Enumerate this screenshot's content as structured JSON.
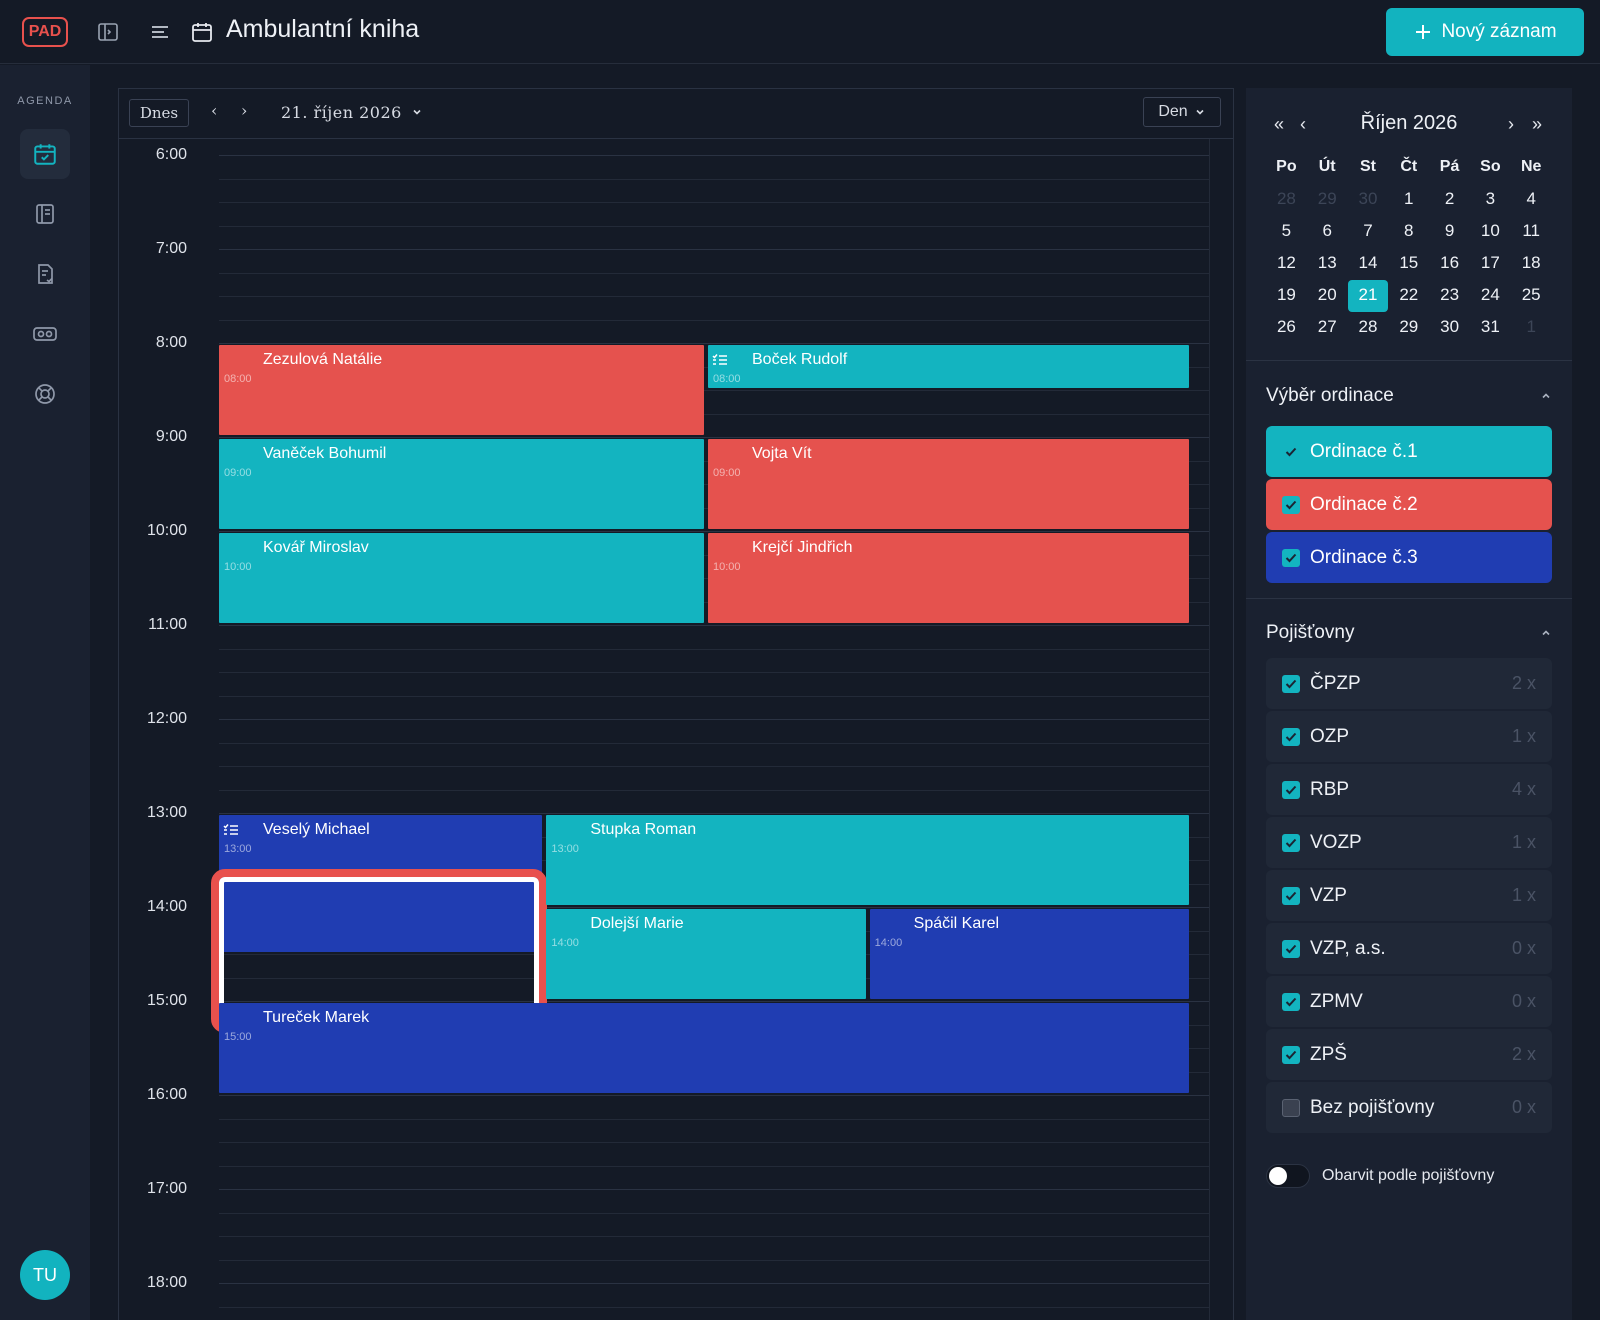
{
  "app": {
    "logo_text": "PAD",
    "title": "Ambulantní kniha",
    "new_button_label": "Nový záznam"
  },
  "rail": {
    "section_label": "AGENDA",
    "items": [
      {
        "icon": "calendar-check-icon",
        "active": true
      },
      {
        "icon": "book-icon",
        "active": false
      },
      {
        "icon": "document-heart-icon",
        "active": false
      },
      {
        "icon": "card-reader-icon",
        "active": false
      },
      {
        "icon": "lifebuoy-icon",
        "active": false
      }
    ],
    "user_initials": "TU"
  },
  "calendar": {
    "today_label": "Dnes",
    "prev_label": "‹",
    "next_label": "›",
    "date_label": "21. říjen 2026",
    "view_label": "Den",
    "hours": [
      "6:00",
      "7:00",
      "8:00",
      "9:00",
      "10:00",
      "11:00",
      "12:00",
      "13:00",
      "14:00",
      "15:00",
      "16:00",
      "17:00",
      "18:00"
    ],
    "events": [
      {
        "name": "Zezulová Natálie",
        "time": "08:00",
        "color": "red",
        "list_icon": false
      },
      {
        "name": "Boček Rudolf",
        "time": "08:00",
        "color": "teal",
        "list_icon": true
      },
      {
        "name": "Vaněček Bohumil",
        "time": "09:00",
        "color": "teal",
        "list_icon": false
      },
      {
        "name": "Vojta Vít",
        "time": "09:00",
        "color": "red",
        "list_icon": false
      },
      {
        "name": "Kovář Miroslav",
        "time": "10:00",
        "color": "teal",
        "list_icon": false
      },
      {
        "name": "Krejčí Jindřich",
        "time": "10:00",
        "color": "red",
        "list_icon": false
      },
      {
        "name": "Veselý Michael",
        "time": "13:00",
        "color": "blue",
        "list_icon": true,
        "highlighted": true
      },
      {
        "name": "Stupka Roman",
        "time": "13:00",
        "color": "teal",
        "list_icon": false
      },
      {
        "name": "Dolejší Marie",
        "time": "14:00",
        "color": "teal",
        "list_icon": false
      },
      {
        "name": "Spáčil Karel",
        "time": "14:00",
        "color": "blue",
        "list_icon": false
      },
      {
        "name": "Tureček Marek",
        "time": "15:00",
        "color": "blue",
        "list_icon": false
      }
    ]
  },
  "mini_calendar": {
    "prev_year": "«",
    "prev_month": "‹",
    "title": "Říjen 2026",
    "next_month": "›",
    "next_year": "»",
    "weekdays": [
      "Po",
      "Út",
      "St",
      "Čt",
      "Pá",
      "So",
      "Ne"
    ],
    "weeks": [
      [
        "28",
        "29",
        "30",
        "1",
        "2",
        "3",
        "4"
      ],
      [
        "5",
        "6",
        "7",
        "8",
        "9",
        "10",
        "11"
      ],
      [
        "12",
        "13",
        "14",
        "15",
        "16",
        "17",
        "18"
      ],
      [
        "19",
        "20",
        "21",
        "22",
        "23",
        "24",
        "25"
      ],
      [
        "26",
        "27",
        "28",
        "29",
        "30",
        "31",
        "1"
      ]
    ],
    "selected_day": "21"
  },
  "ordinace": {
    "title": "Výběr ordinace",
    "items": [
      {
        "label": "Ordinace č.1",
        "color": "#13b4c0",
        "checked": true
      },
      {
        "label": "Ordinace č.2",
        "color": "#e5524e",
        "checked": true
      },
      {
        "label": "Ordinace č.3",
        "color": "#203db2",
        "checked": true
      }
    ]
  },
  "pojistovny": {
    "title": "Pojišťovny",
    "items": [
      {
        "label": "ČPZP",
        "count": "2 x",
        "checked": true
      },
      {
        "label": "OZP",
        "count": "1 x",
        "checked": true
      },
      {
        "label": "RBP",
        "count": "4 x",
        "checked": true
      },
      {
        "label": "VOZP",
        "count": "1 x",
        "checked": true
      },
      {
        "label": "VZP",
        "count": "1 x",
        "checked": true
      },
      {
        "label": "VZP, a.s.",
        "count": "0 x",
        "checked": true
      },
      {
        "label": "ZPMV",
        "count": "0 x",
        "checked": true
      },
      {
        "label": "ZPŠ",
        "count": "2 x",
        "checked": true
      },
      {
        "label": "Bez pojišťovny",
        "count": "0 x",
        "checked": false
      }
    ],
    "toggle_label": "Obarvit podle pojišťovny",
    "toggle_on": false
  }
}
